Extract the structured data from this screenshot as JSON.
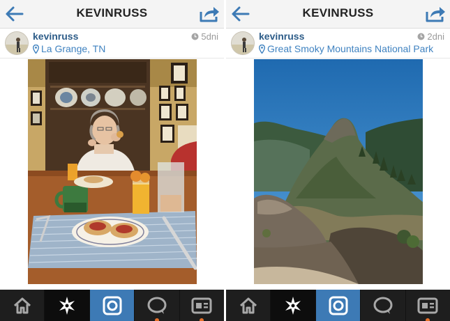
{
  "panels": [
    {
      "title": "KEVINRUSS",
      "username": "kevinruss",
      "location": "La Grange, TN",
      "time": "5dni"
    },
    {
      "title": "KEVINRUSS",
      "username": "kevinruss",
      "location": "Great Smoky Mountains National Park",
      "time": "2dni"
    }
  ],
  "colors": {
    "header_bg": "#f4f4f4",
    "link_blue": "#2d5c88",
    "location_blue": "#3f82c0",
    "tabbar_bg": "#1e1e1e",
    "active_camera_tab": "#3d7ab5",
    "notify_dot": "#e6702b"
  },
  "icons": {
    "back": "arrow-left-icon",
    "share": "share-arrow-icon",
    "tabs": [
      "home-icon",
      "explore-star-icon",
      "camera-icon",
      "activity-bubble-icon",
      "profile-card-icon"
    ]
  }
}
